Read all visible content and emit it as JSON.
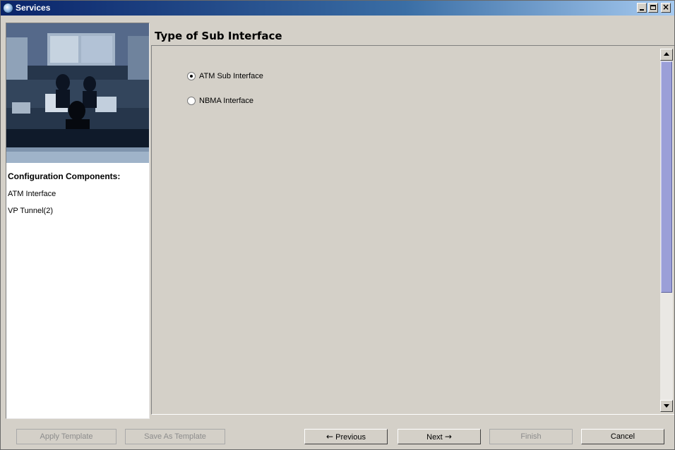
{
  "window": {
    "title": "Services",
    "controls": {
      "minimize": "_",
      "maximize": "□",
      "close": "×"
    }
  },
  "sidebar": {
    "banner_image": "operations-control-room-photo",
    "components_title": "Configuration Components:",
    "items": [
      {
        "label": "ATM Interface"
      },
      {
        "label": "VP Tunnel(2)"
      }
    ]
  },
  "main": {
    "title": "Type of Sub Interface",
    "options": [
      {
        "label": "ATM Sub Interface",
        "selected": true
      },
      {
        "label": "NBMA Interface",
        "selected": false
      }
    ],
    "scrollbar": {
      "thumb_color": "#9b9fd8"
    }
  },
  "footer": {
    "apply_template": "Apply Template",
    "save_as_template": "Save As Template",
    "previous": "Previous",
    "next": "Next",
    "finish": "Finish",
    "cancel": "Cancel",
    "previous_icon": "←",
    "next_icon": "→"
  },
  "colors": {
    "titlebar_start": "#0a246a",
    "titlebar_end": "#a6caf0",
    "surface": "#d4d0c8"
  }
}
